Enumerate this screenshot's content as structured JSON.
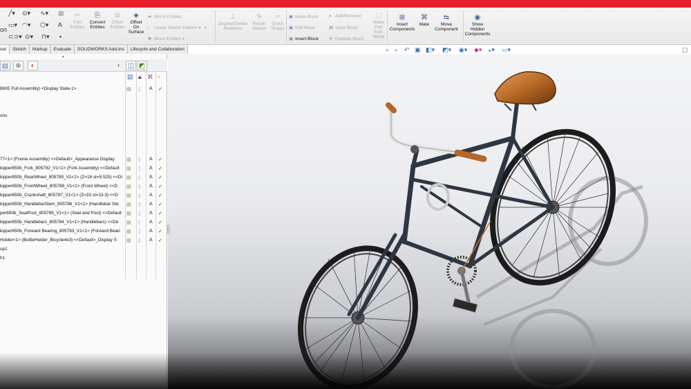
{
  "app": {
    "accent_color": "#e8202a"
  },
  "ribbon": {
    "sketch_tools_partial": "on",
    "buttons": {
      "trim_entities": "Trim Entities",
      "convert_entities": "Convert Entities",
      "offset_entities": "Offset Entities",
      "offset_on_surface": "Offset On Surface",
      "mirror_entities": "Mirror Entities",
      "linear_sketch_pattern": "Linear Sketch Pattern",
      "move_entities": "Move Entities",
      "display_delete_relations": "Display/Delete Relations",
      "repair_sketch": "Repair Sketch",
      "quick_snaps": "Quick Snaps",
      "make_block": "Make Block",
      "edit_block": "Edit Block",
      "insert_block": "Insert Block",
      "add_remove": "Add/Remove",
      "save_block": "Save Block",
      "explode_block": "Explode Block",
      "make_part_from_block": "Make Part from Block",
      "insert_components": "Insert Components",
      "mate": "Mate",
      "move_component": "Move Component",
      "show_hidden_components": "Show Hidden Components"
    }
  },
  "tabs": [
    "out",
    "Sketch",
    "Markup",
    "Evaluate",
    "SOLIDWORKS Add-Ins",
    "Lifecycle and Collaboration"
  ],
  "tree": {
    "root": "BIKE Full Assembly) <Display State-1>",
    "items": [
      "ons",
      "77<1> (Frame Assembly) <<Default>_Appearance Display",
      "kipper650b_Fork_805792_V1<1> (Fork Assembly) <<Default",
      "kipper650b_RearWheel_805789_V1<1> (Z=18 st=9.525) <<Di",
      "kipper650b_FrontWheel_805788_V1<1> (Front Wheel) <<D",
      "kipper650b_Crankshaft_805787_V1<1> (Z=33 st=13.3) <<D",
      "kipper650b_HandlebarStem_805786_V1<1> (Handlebar Ste",
      "per650b_SeatPost_805785_V1<1> (Seat and Post) <<Default",
      "kipper650b_Handlebars_805784_V1<1> (Handlebars) <<De",
      "kipper650b_Forward Bearing_805783_V1<1> (Forward Beari",
      "Holder<1> (BottleHolder_Bicycle4x3) <<Default>_Display S",
      "up1",
      "h1"
    ],
    "col_value": "A"
  }
}
